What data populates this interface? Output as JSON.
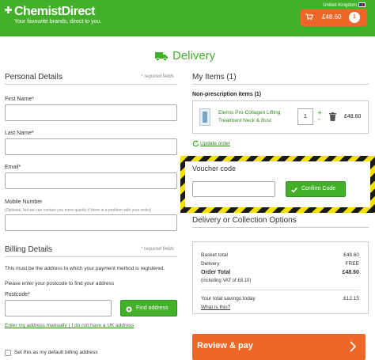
{
  "header": {
    "brand": "ChemistDirect",
    "tagline": "Your favourite brands, direct to you.",
    "region": "United Kingdom",
    "basket_total": "£48.60",
    "basket_count": "1",
    "brand_color": "#43b02a",
    "accent_color": "#ec6728"
  },
  "page": {
    "title": "Delivery",
    "title_icon": "truck-icon"
  },
  "personal": {
    "title": "Personal Details",
    "required_note": "* required fields",
    "first_name_label": "First Name*",
    "first_name_value": "",
    "last_name_label": "Last Name*",
    "last_name_value": "",
    "email_label": "Email*",
    "email_value": "",
    "mobile_label": "Mobile Number",
    "mobile_hint": "(Optional, but we can contact you more quickly if there is a problem with your order)",
    "mobile_value": ""
  },
  "billing": {
    "title": "Billing Details",
    "required_note": "* required fields",
    "note": "This must be the address to which your payment method is registered.",
    "postcode_prompt": "Please enter your postcode to find your address",
    "postcode_label": "Postcode*",
    "postcode_value": "",
    "find_button": "Find address",
    "manual_link": "Enter my address manually ( I do not have a UK address",
    "default_checkbox_label": "Set this as my default billing address",
    "default_checked": false
  },
  "items": {
    "title": "My Items (1)",
    "group_title": "Non-prescription items (1)",
    "products": [
      {
        "name": "Elemis Pro-Collagen Lifting Treatment Neck & Bust",
        "quantity": "1",
        "price": "£48.60"
      }
    ],
    "update_link": "Update order"
  },
  "voucher": {
    "title": "Voucher code",
    "value": "",
    "confirm_button": "Confirm Code"
  },
  "delivery": {
    "title": "Delivery or Collection Options"
  },
  "summary": {
    "basket_total_label": "Basket total",
    "basket_total_value": "£48.60",
    "delivery_label": "Delivery",
    "delivery_value": "FREE",
    "order_total_label": "Order Total",
    "order_total_value": "£48.60",
    "vat_note": "(including VAT of £8.10)",
    "savings_label": "Your total savings today",
    "savings_value": "£12.15",
    "what_link": "What is this?"
  },
  "checkout": {
    "review_button": "Review & pay"
  }
}
